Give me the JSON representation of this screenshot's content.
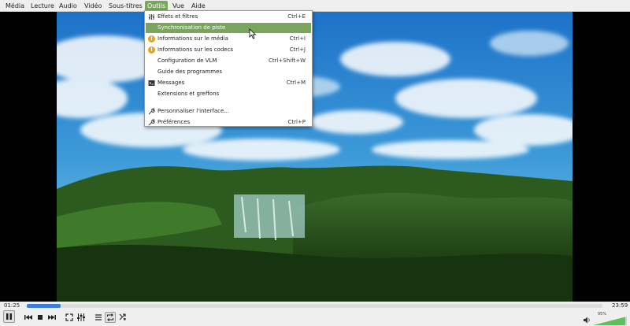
{
  "menubar": {
    "items": [
      {
        "label": "Média"
      },
      {
        "label": "Lecture"
      },
      {
        "label": "Audio"
      },
      {
        "label": "Vidéo"
      },
      {
        "label": "Sous-titres"
      },
      {
        "label": "Outils"
      },
      {
        "label": "Vue"
      },
      {
        "label": "Aide"
      }
    ],
    "active": "Outils"
  },
  "tools_menu": {
    "items": [
      {
        "label": "Effets et filtres",
        "shortcut": "Ctrl+E",
        "icon": "equalizer-icon"
      },
      {
        "label": "Synchronisation de piste",
        "shortcut": "",
        "icon": ""
      },
      {
        "label": "Informations sur le média",
        "shortcut": "Ctrl+I",
        "icon": "info-icon"
      },
      {
        "label": "Informations sur les codecs",
        "shortcut": "Ctrl+J",
        "icon": "info-icon"
      },
      {
        "label": "Configuration de VLM",
        "shortcut": "Ctrl+Shift+W",
        "icon": ""
      },
      {
        "label": "Guide des programmes",
        "shortcut": "",
        "icon": ""
      },
      {
        "label": "Messages",
        "shortcut": "Ctrl+M",
        "icon": "terminal-icon"
      },
      {
        "label": "Extensions et greffons",
        "shortcut": "",
        "icon": ""
      },
      {
        "label": "Personnaliser l'interface...",
        "shortcut": "",
        "icon": "wrench-icon"
      },
      {
        "label": "Préférences",
        "shortcut": "Ctrl+P",
        "icon": "wrench-icon"
      }
    ],
    "highlighted": "Synchronisation de piste"
  },
  "player": {
    "elapsed": "01:25",
    "total": "23:59",
    "progress": 0.059,
    "volume_label": "95%",
    "volume": 0.95
  },
  "colors": {
    "accent": "#7aa55c",
    "seek_fill": "#3d7fd6",
    "volume_fill": "#5cc05c"
  }
}
